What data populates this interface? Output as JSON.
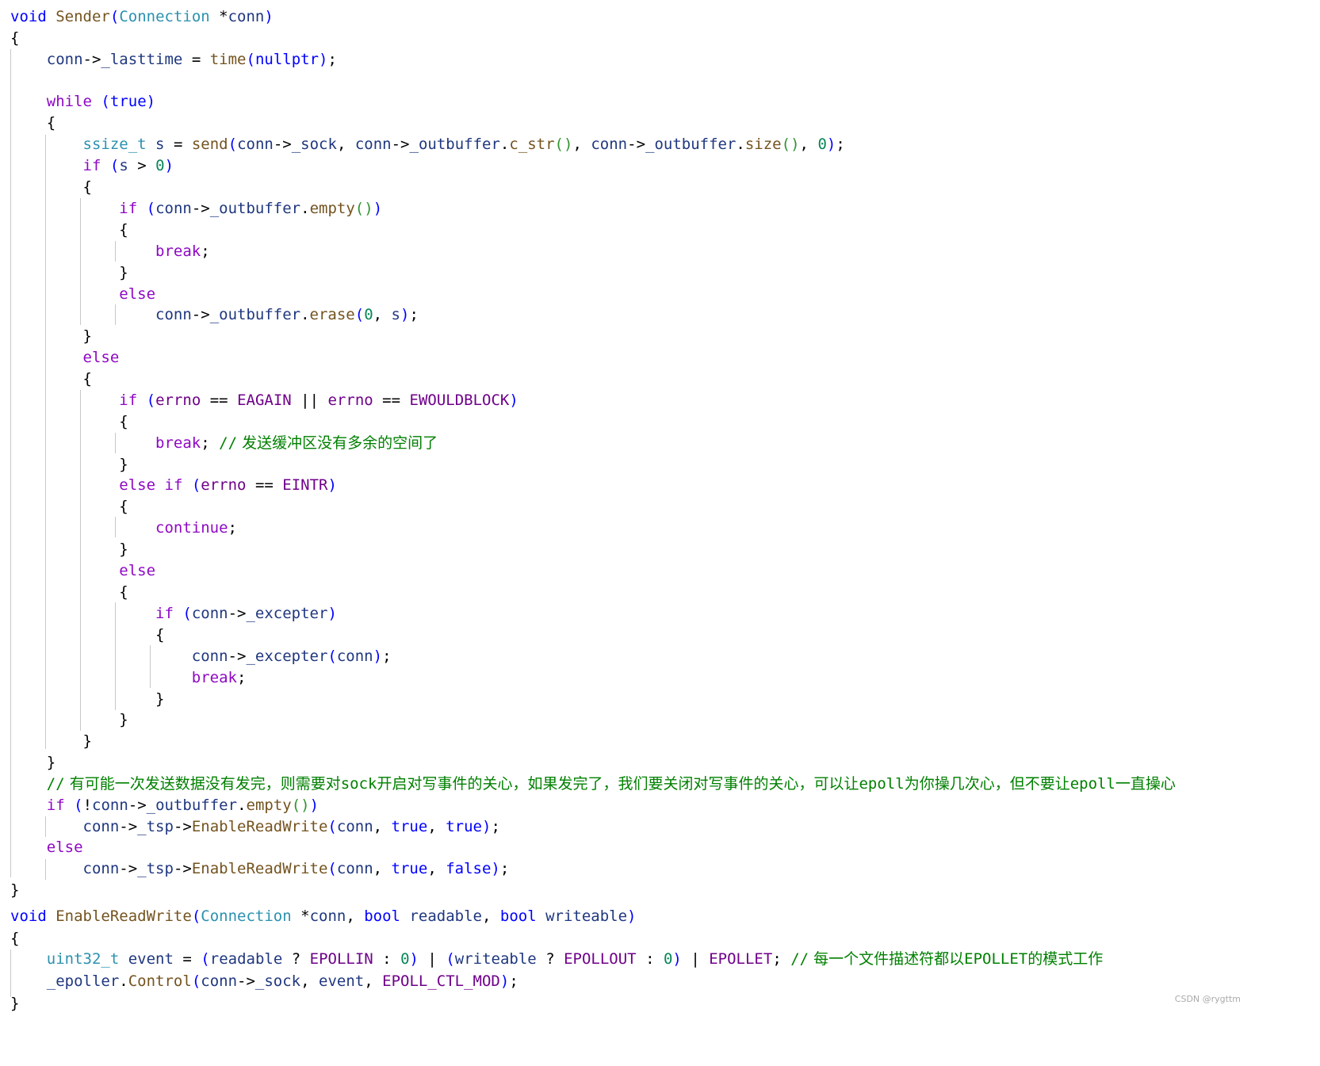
{
  "editor": {
    "language": "cpp",
    "lines": [
      "void Sender(Connection *conn)",
      "{",
      "    conn->_lasttime = time(nullptr);",
      "",
      "    while (true)",
      "    {",
      "        ssize_t s = send(conn->_sock, conn->_outbuffer.c_str(), conn->_outbuffer.size(), 0);",
      "        if (s > 0)",
      "        {",
      "            if (conn->_outbuffer.empty())",
      "            {",
      "                break;",
      "            }",
      "            else",
      "                conn->_outbuffer.erase(0, s);",
      "        }",
      "        else",
      "        {",
      "            if (errno == EAGAIN || errno == EWOULDBLOCK)",
      "            {",
      "                break; // 发送缓冲区没有多余的空间了",
      "            }",
      "            else if (errno == EINTR)",
      "            {",
      "                continue;",
      "            }",
      "            else",
      "            {",
      "                if (conn->_excepter)",
      "                {",
      "                    conn->_excepter(conn);",
      "                    break;",
      "                }",
      "            }",
      "        }",
      "    }",
      "    // 有可能一次发送数据没有发完，则需要对sock开启对写事件的关心，如果发完了，我们要关闭对写事件的关心，可以让epoll为你操几次心，但不要让epoll一直操心",
      "    if (!conn->_outbuffer.empty())",
      "        conn->_tsp->EnableReadWrite(conn, true, true);",
      "    else",
      "        conn->_tsp->EnableReadWrite(conn, true, false);",
      "}",
      "void EnableReadWrite(Connection *conn, bool readable, bool writeable)",
      "{",
      "    uint32_t event = (readable ? EPOLLIN : 0) | (writeable ? EPOLLOUT : 0) | EPOLLET; // 每一个文件描述符都以EPOLLET的模式工作",
      "    _epoller.Control(conn->_sock, event, EPOLL_CTL_MOD);",
      "}"
    ]
  },
  "watermark": "CSDN @rygttm"
}
